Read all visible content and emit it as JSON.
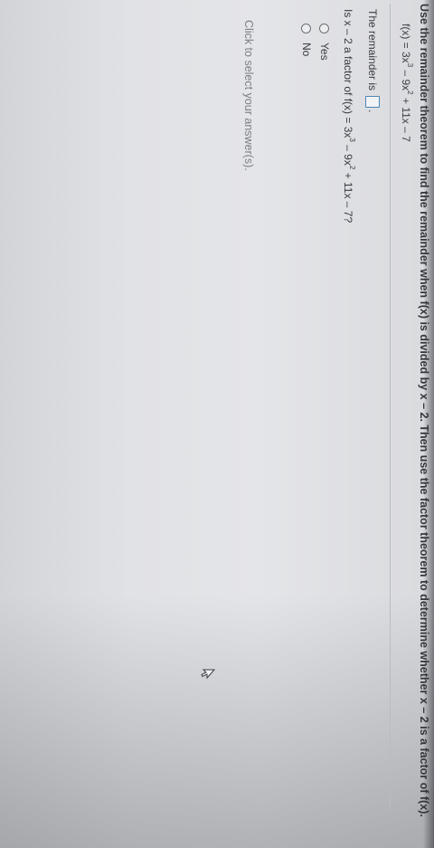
{
  "question": {
    "instruction": "Use the remainder theorem to find the remainder when f(x) is divided by x – 2. Then use the factor theorem to determine whether x – 2 is a factor of f(x).",
    "function": {
      "lhs": "f(x) = 3x",
      "exp1": "3",
      "mid": " – 9x",
      "exp2": "2",
      "rhs": " + 11x – 7"
    }
  },
  "part1": {
    "prompt": "The remainder is",
    "suffix": "."
  },
  "part2": {
    "prompt_start": "Is x – 2 a factor of f(x) = 3x",
    "exp1": "3",
    "mid": " – 9x",
    "exp2": "2",
    "prompt_end": " + 11x – 7?",
    "options": [
      {
        "label": "Yes"
      },
      {
        "label": "No"
      }
    ]
  },
  "hint": "Click to select your answer(s).",
  "icons": {
    "cursor": "mouse-pointer-icon"
  }
}
